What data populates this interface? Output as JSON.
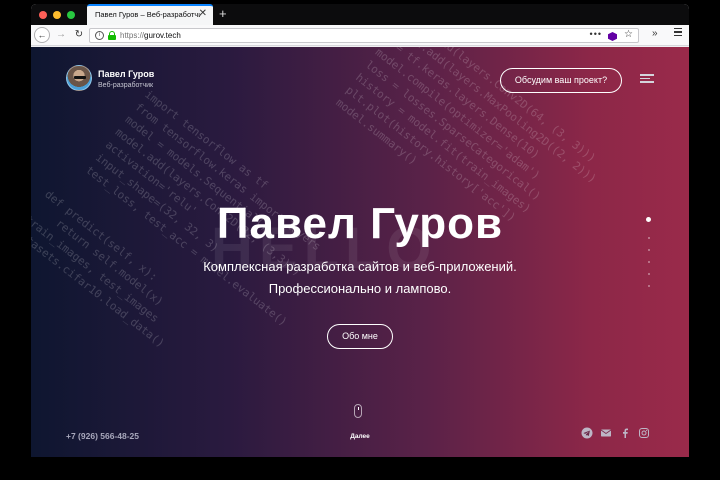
{
  "browser": {
    "tab_title": "Павел Гуров – Веб-разработчик",
    "tab_close": "✕",
    "new_tab": "+",
    "url_protocol": "https://",
    "url_host": "gurov.tech",
    "page_actions": "•••"
  },
  "header": {
    "name": "Павел Гуров",
    "role": "Веб-разработчик",
    "cta_label": "Обсудим ваш проект?"
  },
  "hero": {
    "background_word": "HELLO",
    "title": "Павел Гуров",
    "subtitle_line1": "Комплексная разработка сайтов и веб-приложений.",
    "subtitle_line2": "Профессионально и лампово.",
    "about_label": "Обо мне"
  },
  "footer": {
    "next_label": "Далее",
    "phone": "+7 (926) 566-48-25",
    "socials": [
      "telegram-icon",
      "mail-icon",
      "facebook-icon",
      "instagram-icon"
    ]
  },
  "pager": {
    "count": 6,
    "active": 0
  },
  "colors": {
    "gradient_left": "#0e1630",
    "gradient_right": "#9a2a4a",
    "accent": "#ffffff"
  }
}
